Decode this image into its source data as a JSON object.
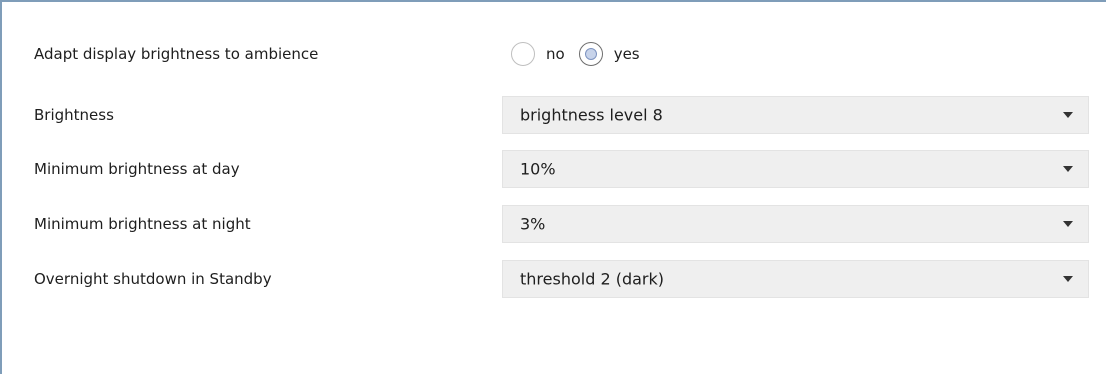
{
  "settings": {
    "adapt": {
      "label": "Adapt display brightness to ambience",
      "options": [
        "no",
        "yes"
      ],
      "selected": "yes"
    },
    "brightness": {
      "label": "Brightness",
      "value": "brightness level 8"
    },
    "min_day": {
      "label": "Minimum brightness at day",
      "value": "10%"
    },
    "min_night": {
      "label": "Minimum brightness at night",
      "value": "3%"
    },
    "overnight": {
      "label": "Overnight shutdown in Standby",
      "value": "threshold 2 (dark)"
    }
  },
  "icons": {
    "dropdown": "chevron-down-icon"
  },
  "colors": {
    "frame": "#7f9db9",
    "dropdown_bg": "#efefef",
    "radio_selected_fill": "#c7d3ea"
  }
}
